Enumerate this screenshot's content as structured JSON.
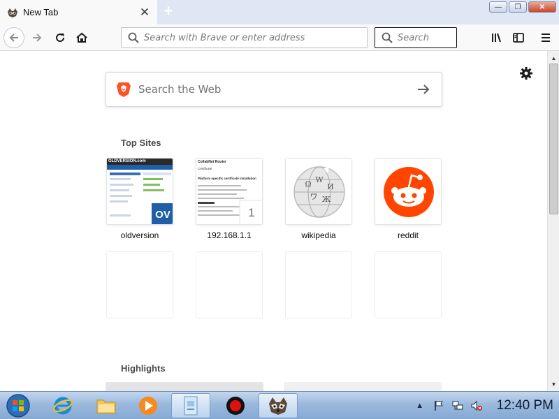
{
  "tab": {
    "title": "New Tab",
    "close_glyph": "✕",
    "new_tab_glyph": "+"
  },
  "window_controls": {
    "minimize": "—",
    "maximize": "❐",
    "close": "✕"
  },
  "navbar": {
    "address_placeholder": "Search with Brave or enter address",
    "search_placeholder": "Search"
  },
  "newtab": {
    "websearch_placeholder": "Search the Web",
    "top_sites_title": "Top Sites",
    "highlights_title": "Highlights",
    "top_sites": [
      {
        "label": "oldversion",
        "icon": "oldversion-thumbnail",
        "badge": "OV",
        "header": "OLDVERSION.com"
      },
      {
        "label": "192.168.1.1",
        "icon": "router-page-thumbnail",
        "badge": "1",
        "header": "CollabNet Router",
        "lines": [
          "Certificate",
          "Platform specific certificate installation"
        ]
      },
      {
        "label": "wikipedia",
        "icon": "wikipedia-globe-icon"
      },
      {
        "label": "reddit",
        "icon": "reddit-alien-icon"
      }
    ]
  },
  "taskbar": {
    "clock": "12:40 PM",
    "apps": [
      "start-orb-icon",
      "internet-explorer-icon",
      "file-explorer-icon",
      "media-player-icon",
      "document-app-icon",
      "record-app-icon",
      "brave-raccoon-icon"
    ]
  },
  "colors": {
    "accent": "#0a84ff",
    "reddit": "#ff4500",
    "taskbar": "#9bb9dd"
  }
}
